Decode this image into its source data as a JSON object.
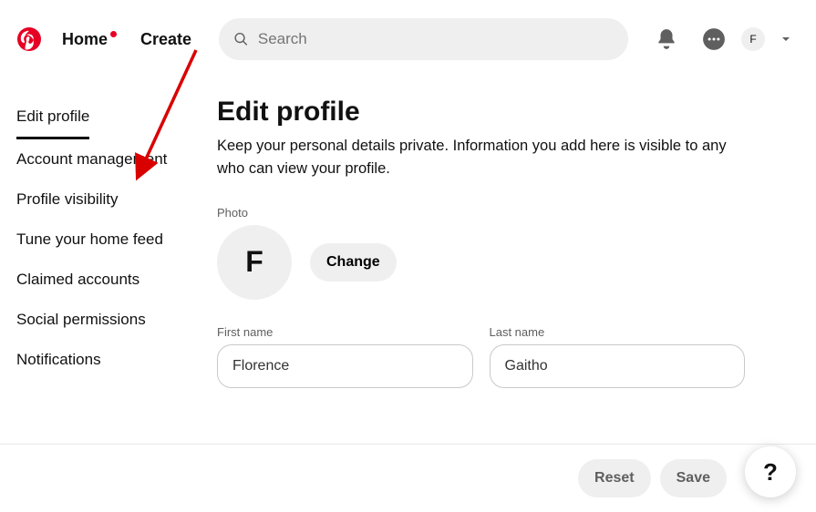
{
  "header": {
    "home_label": "Home",
    "create_label": "Create",
    "search_placeholder": "Search",
    "avatar_letter": "F"
  },
  "sidebar": {
    "items": [
      {
        "label": "Edit profile",
        "active": true
      },
      {
        "label": "Account management",
        "active": false
      },
      {
        "label": "Profile visibility",
        "active": false
      },
      {
        "label": "Tune your home feed",
        "active": false
      },
      {
        "label": "Claimed accounts",
        "active": false
      },
      {
        "label": "Social permissions",
        "active": false
      },
      {
        "label": "Notifications",
        "active": false
      }
    ]
  },
  "main": {
    "title": "Edit profile",
    "subtitle": "Keep your personal details private. Information you add here is visible to any who can view your profile.",
    "photo_label": "Photo",
    "avatar_letter": "F",
    "change_label": "Change",
    "first_name_label": "First name",
    "first_name_value": "Florence",
    "last_name_label": "Last name",
    "last_name_value": "Gaitho"
  },
  "footer": {
    "reset_label": "Reset",
    "save_label": "Save",
    "help_label": "?"
  }
}
